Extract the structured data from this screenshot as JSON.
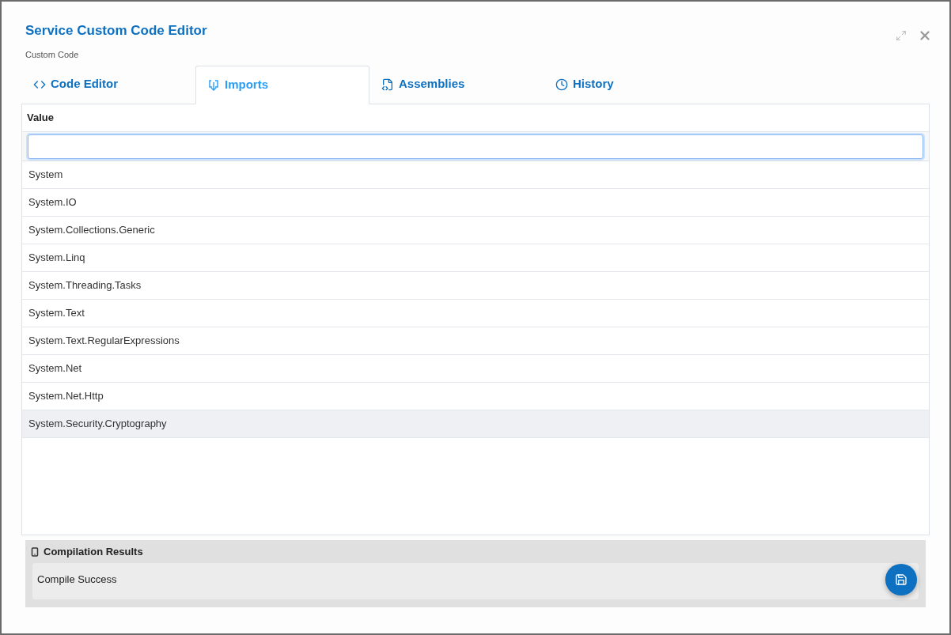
{
  "dialog": {
    "title": "Service Custom Code Editor",
    "subtitle": "Custom Code"
  },
  "tabs": [
    {
      "label": "Code Editor",
      "kind": "code",
      "selected": false
    },
    {
      "label": "Imports",
      "kind": "imports",
      "selected": true
    },
    {
      "label": "Assemblies",
      "kind": "assemblies",
      "selected": false
    },
    {
      "label": "History",
      "kind": "history",
      "selected": false
    }
  ],
  "table": {
    "columns": [
      "Value"
    ],
    "rows": [
      {
        "value": "System",
        "selected": false
      },
      {
        "value": "System.IO",
        "selected": false
      },
      {
        "value": "System.Collections.Generic",
        "selected": false
      },
      {
        "value": "System.Linq",
        "selected": false
      },
      {
        "value": "System.Threading.Tasks",
        "selected": false
      },
      {
        "value": "System.Text",
        "selected": false
      },
      {
        "value": "System.Text.RegularExpressions",
        "selected": false
      },
      {
        "value": "System.Net",
        "selected": false
      },
      {
        "value": "System.Net.Http",
        "selected": false
      },
      {
        "value": "System.Security.Cryptography",
        "selected": true
      }
    ]
  },
  "compilation": {
    "title": "Compilation Results",
    "message": "Compile Success"
  }
}
